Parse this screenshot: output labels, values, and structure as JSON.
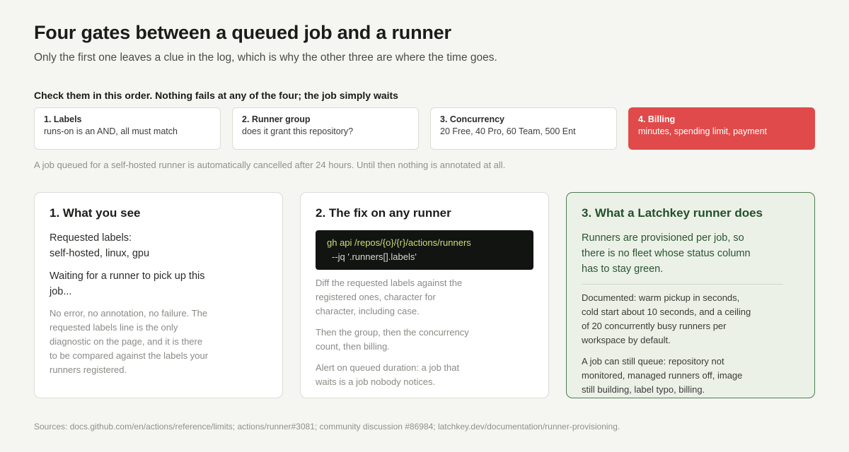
{
  "header": {
    "title": "Four gates between a queued job and a runner",
    "subtitle": "Only the first one leaves a clue in the log, which is why the other three are where the time goes."
  },
  "gates": {
    "heading": "Check them in this order. Nothing fails at any of the four; the job simply waits",
    "items": [
      {
        "title": "1. Labels",
        "desc": "runs-on is an AND, all must match"
      },
      {
        "title": "2. Runner group",
        "desc": "does it grant this repository?"
      },
      {
        "title": "3. Concurrency",
        "desc": "20 Free, 40 Pro, 60 Team, 500 Ent"
      },
      {
        "title": "4. Billing",
        "desc": "minutes, spending limit, payment"
      }
    ],
    "active_color": "#e04a4a",
    "note": "A job queued for a self-hosted runner is automatically cancelled after 24 hours. Until then nothing is annotated at all."
  },
  "cards": {
    "see": {
      "title": "1. What you see",
      "labels_line1": "Requested labels:",
      "labels_line2": "self-hosted, linux, gpu",
      "waiting": "Waiting for a runner to pick up this job...",
      "note": "No error, no annotation, no failure. The requested labels line is the only diagnostic on the page, and it is there to be compared against the labels your runners registered."
    },
    "fix": {
      "title": "2. The fix on any runner",
      "code_line1": "gh api /repos/{o}/{r}/actions/runners",
      "code_line2": "--jq '.runners[].labels'",
      "p1": "Diff the requested labels against the registered ones, character for character, including case.",
      "p2": "Then the group, then the concurrency count, then billing.",
      "p3": "Alert on queued duration: a job that waits is a job nobody notices."
    },
    "latchkey": {
      "title": "3. What a Latchkey runner does",
      "lead": "Runners are provisioned per job, so there is no fleet whose status column has to stay green.",
      "p1": "Documented: warm pickup in seconds, cold start about 10 seconds, and a ceiling of 20 concurrently busy runners per workspace by default.",
      "p2": "A job can still queue: repository not monitored, managed runners off, image still building, label typo, billing.",
      "accent_color": "#4d7c52"
    }
  },
  "footer": {
    "sources": "Sources: docs.github.com/en/actions/reference/limits; actions/runner#3081; community discussion #86984; latchkey.dev/documentation/runner-provisioning."
  }
}
